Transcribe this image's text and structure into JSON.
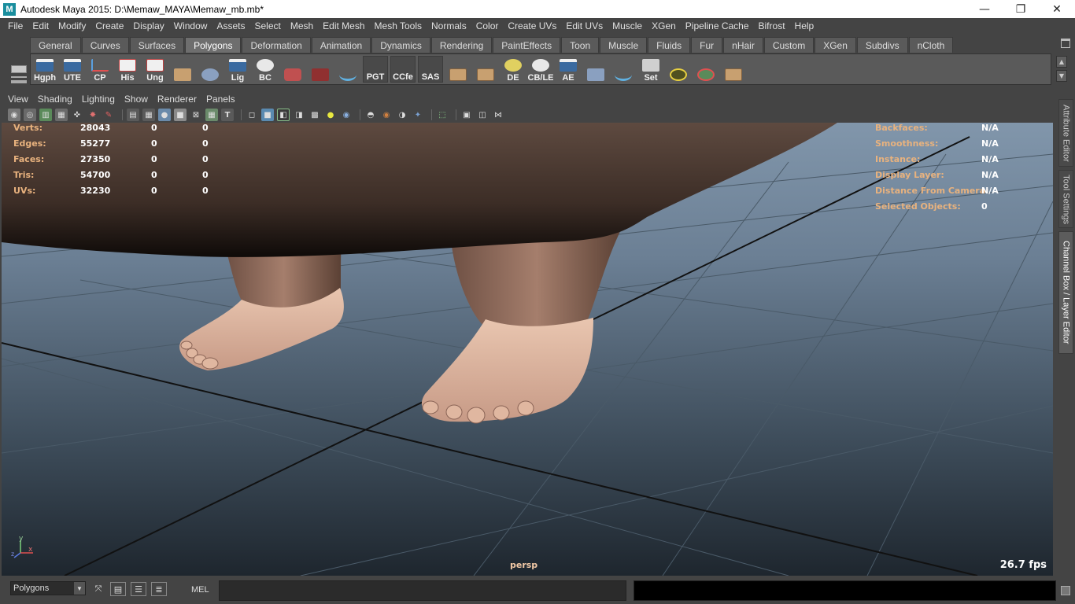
{
  "window": {
    "title": "Autodesk Maya 2015: D:\\Memaw_MAYA\\Memaw_mb.mb*",
    "app_icon": "M",
    "minimize": "—",
    "restore": "❐",
    "close": "✕"
  },
  "menubar": [
    "File",
    "Edit",
    "Modify",
    "Create",
    "Display",
    "Window",
    "Assets",
    "Select",
    "Mesh",
    "Edit Mesh",
    "Mesh Tools",
    "Normals",
    "Color",
    "Create UVs",
    "Edit UVs",
    "Muscle",
    "XGen",
    "Pipeline Cache",
    "Bifrost",
    "Help"
  ],
  "shelf_tabs": [
    "General",
    "Curves",
    "Surfaces",
    "Polygons",
    "Deformation",
    "Animation",
    "Dynamics",
    "Rendering",
    "PaintEffects",
    "Toon",
    "Muscle",
    "Fluids",
    "Fur",
    "nHair",
    "Custom",
    "XGen",
    "Subdivs",
    "nCloth"
  ],
  "active_shelf_tab": "Polygons",
  "shelf_buttons": [
    {
      "label": "Hgph",
      "icon": "window-icon"
    },
    {
      "label": "UTE",
      "icon": "window-icon"
    },
    {
      "label": "CP",
      "icon": "axes-icon"
    },
    {
      "label": "His",
      "icon": "pencil-icon"
    },
    {
      "label": "Ung",
      "icon": "pencil-icon"
    },
    {
      "label": "",
      "icon": "book-icon"
    },
    {
      "label": "",
      "icon": "globe-icon"
    },
    {
      "label": "Lig",
      "icon": "window-icon"
    },
    {
      "label": "BC",
      "icon": "eye-icon"
    },
    {
      "label": "",
      "icon": "transform-icon"
    },
    {
      "label": "",
      "icon": "camera-icon"
    },
    {
      "label": "",
      "icon": "curve-icon"
    },
    {
      "label": "PGT",
      "icon": ""
    },
    {
      "label": "CCfe",
      "icon": ""
    },
    {
      "label": "SAS",
      "icon": ""
    },
    {
      "label": "",
      "icon": "grid-icon"
    },
    {
      "label": "",
      "icon": "grid-icon"
    },
    {
      "label": "DE",
      "icon": "light-icon"
    },
    {
      "label": "CB/LE",
      "icon": "eye-icon"
    },
    {
      "label": "AE",
      "icon": "window-icon"
    },
    {
      "label": "",
      "icon": "spotlight-icon"
    },
    {
      "label": "",
      "icon": "curve-icon"
    },
    {
      "label": "Set",
      "icon": "key-icon"
    },
    {
      "label": "",
      "icon": "target-icon"
    },
    {
      "label": "",
      "icon": "sphere-icon"
    },
    {
      "label": "",
      "icon": "grid-icon"
    }
  ],
  "panel_menu": [
    "View",
    "Shading",
    "Lighting",
    "Show",
    "Renderer",
    "Panels"
  ],
  "hud_left": [
    {
      "label": "Verts:",
      "v1": "28043",
      "v2": "0",
      "v3": "0"
    },
    {
      "label": "Edges:",
      "v1": "55277",
      "v2": "0",
      "v3": "0"
    },
    {
      "label": "Faces:",
      "v1": "27350",
      "v2": "0",
      "v3": "0"
    },
    {
      "label": "Tris:",
      "v1": "54700",
      "v2": "0",
      "v3": "0"
    },
    {
      "label": "UVs:",
      "v1": "32230",
      "v2": "0",
      "v3": "0"
    }
  ],
  "hud_right": [
    {
      "label": "Backfaces:",
      "value": "N/A"
    },
    {
      "label": "Smoothness:",
      "value": "N/A"
    },
    {
      "label": "Instance:",
      "value": "N/A"
    },
    {
      "label": "Display Layer:",
      "value": "N/A"
    },
    {
      "label": "Distance From Camera:",
      "value": "N/A"
    },
    {
      "label": "Selected Objects:",
      "value": "0"
    }
  ],
  "viewport": {
    "camera": "persp",
    "fps": "26.7 fps",
    "axis_y": "y",
    "axis_x": "x",
    "axis_z": "z"
  },
  "right_dock_tabs": [
    "Attribute Editor",
    "Tool Settings",
    "Channel Box / Layer Editor"
  ],
  "cmdline": {
    "layout_value": "Polygons",
    "language": "MEL"
  },
  "colors": {
    "hud_label": "#e8b27e",
    "skin": "#e9bfa5",
    "dress": "#3a2a22",
    "grid": "#111111"
  }
}
